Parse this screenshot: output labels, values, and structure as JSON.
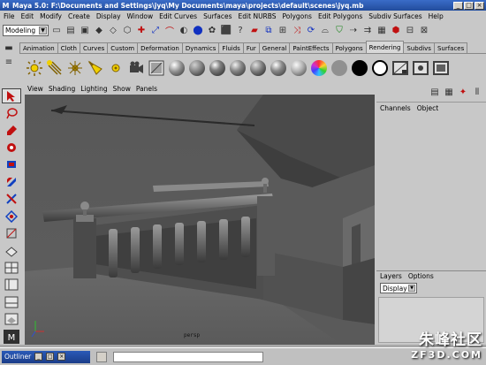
{
  "window": {
    "title": "Maya 5.0: F:\\Documents and Settings\\jyq\\My Documents\\maya\\projects\\default\\scenes\\jyq.mb"
  },
  "menubar": [
    "File",
    "Edit",
    "Modify",
    "Create",
    "Display",
    "Window",
    "Edit Curves",
    "Surfaces",
    "Edit NURBS",
    "Polygons",
    "Edit Polygons",
    "Subdiv Surfaces",
    "Help"
  ],
  "status": {
    "mode": "Modeling"
  },
  "shelf": {
    "tabs": [
      "Animation",
      "Cloth",
      "Curves",
      "Custom",
      "Deformation",
      "Dynamics",
      "Fluids",
      "Fur",
      "General",
      "PaintEffects",
      "Polygons",
      "Rendering",
      "Subdivs",
      "Surfaces"
    ],
    "active_tab": "Rendering"
  },
  "viewport": {
    "menu": [
      "View",
      "Shading",
      "Lighting",
      "Show",
      "Panels"
    ],
    "camera_label": "persp"
  },
  "channelbox": {
    "menu": [
      "Channels",
      "Object"
    ]
  },
  "layers": {
    "menu": [
      "Layers",
      "Options"
    ],
    "display_value": "Display"
  },
  "taskbar": {
    "outliner_label": "Outliner"
  },
  "watermark": {
    "main": "朱峰社区",
    "sub": "ZF3D.COM"
  },
  "colors": {
    "title_bg": "#224c9c",
    "viewport_bg": "#555555",
    "ui_bg": "#c8c8c8"
  }
}
